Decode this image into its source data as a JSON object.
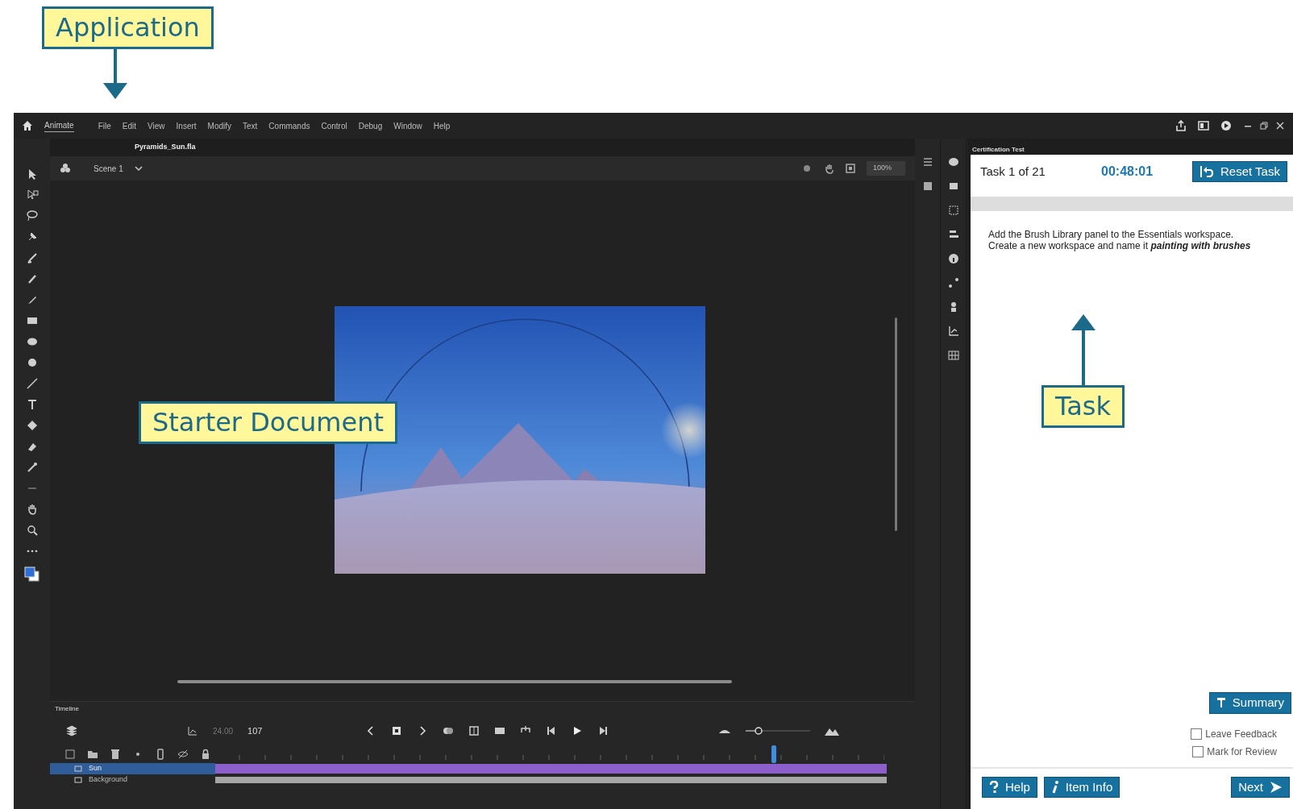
{
  "callouts": [
    {
      "label": "Application",
      "kind": "down"
    },
    {
      "label": "Starter Document",
      "kind": "plain"
    },
    {
      "label": "Task",
      "kind": "up"
    }
  ],
  "app": {
    "name": "Animate",
    "menu": [
      "File",
      "Edit",
      "View",
      "Insert",
      "Modify",
      "Text",
      "Commands",
      "Control",
      "Debug",
      "Window",
      "Help"
    ]
  },
  "document_tabs": [
    {
      "label": "Pyramids_Sun.fla",
      "selected": true
    }
  ],
  "scene": "Scene 1",
  "zoom": "100%",
  "timeline": {
    "tabs": [
      {
        "label": "Timeline",
        "selected": true
      }
    ],
    "fps": "24.00",
    "frame": "107",
    "zoom_slider": {
      "level": 0.2
    },
    "layers": [
      {
        "name": "Sun",
        "selected": true
      },
      {
        "name": "Background",
        "selected": false
      }
    ]
  },
  "exam": {
    "panel_title": "Certification Test",
    "task_counter": "Task 1 of 21",
    "timer": "00:48:01",
    "reset_button": "Reset Task",
    "instructions": [
      "Add the Brush Library panel to the Essentials workspace.",
      "Create a new workspace and name it **painting with brushes**"
    ],
    "summary_button": "Summary",
    "checkboxes": [
      {
        "label": "Leave Feedback",
        "checked": false
      },
      {
        "label": "Mark for Review",
        "checked": false
      }
    ],
    "help_button": "Help",
    "item_info_button": "Item Info",
    "next_button": "Next"
  }
}
